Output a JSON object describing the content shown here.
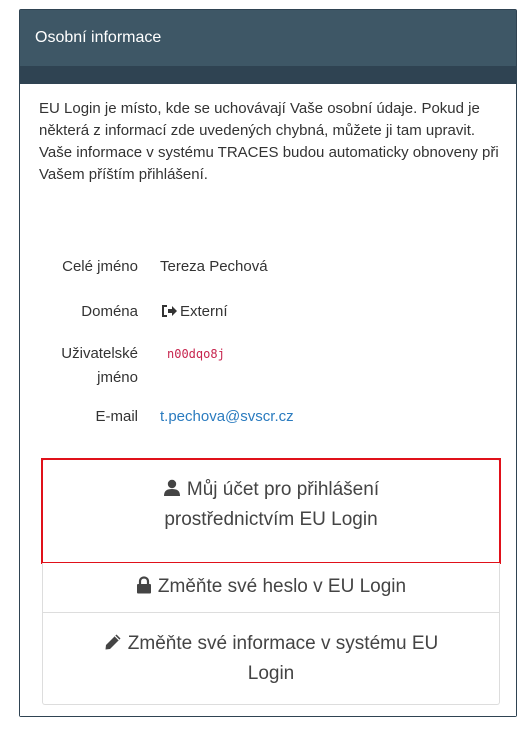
{
  "panel": {
    "title": "Osobní informace"
  },
  "intro": {
    "text": "EU Login je místo, kde se uchovávají Vaše osobní údaje. Pokud je některá z informací zde uvedených chybná, můžete ji tam upravit. Vaše informace v systému TRACES budou automaticky obnoveny při Vašem příštím přihlášení."
  },
  "info": {
    "full_name_label": "Celé jméno",
    "full_name_value": "Tereza Pechová",
    "domain_label": "Doména",
    "domain_value": "Externí",
    "domain_icon": "sign-in-icon",
    "username_label_line1": "Uživatelské",
    "username_label_line2": "jméno",
    "username_value": "n00dqo8j",
    "email_label": "E-mail",
    "email_value": "t.pechova@svscr.cz"
  },
  "actions": {
    "account_line1": "Můj účet pro přihlášení",
    "account_line2": "prostřednictvím EU Login",
    "account_icon": "user-icon",
    "password": "Změňte své heslo v EU Login",
    "password_icon": "lock-icon",
    "info_line1": "Změňte své informace v systému EU",
    "info_line2": "Login",
    "info_icon": "pencil-icon"
  },
  "colors": {
    "header_bg": "#3e5766",
    "frame": "#2f4352",
    "highlight": "#e0111a",
    "link": "#2a7bbf",
    "code": "#c7254e"
  }
}
